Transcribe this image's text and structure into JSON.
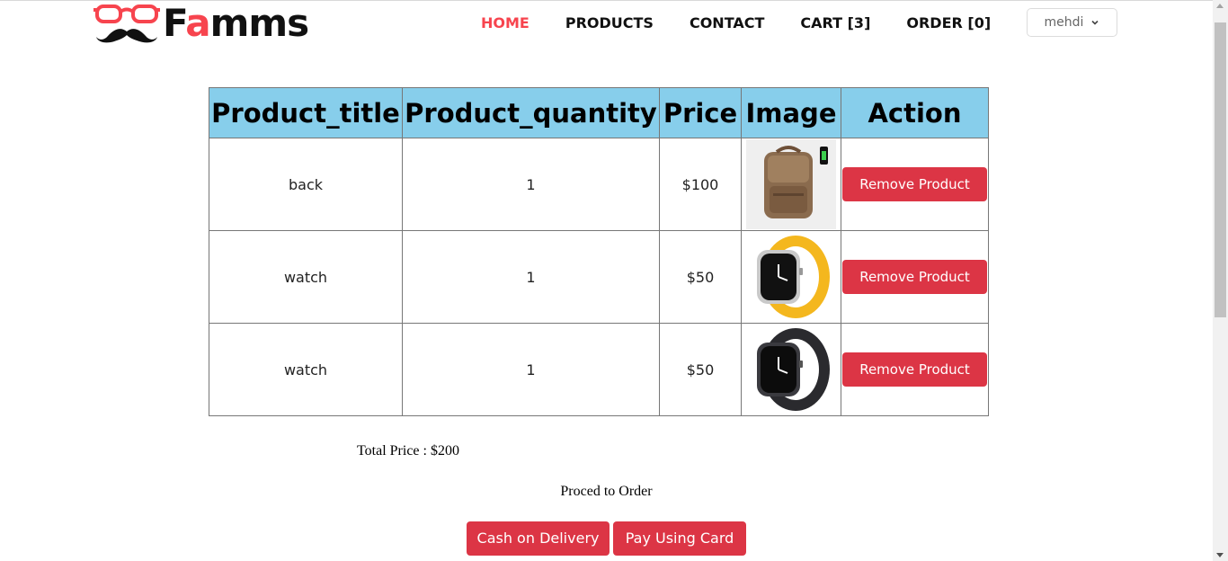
{
  "brand": {
    "name_prefix": "F",
    "name_accent": "a",
    "name_suffix": "mms"
  },
  "nav": {
    "items": [
      {
        "label": "HOME"
      },
      {
        "label": "PRODUCTS"
      },
      {
        "label": "CONTACT"
      },
      {
        "label": "CART [3]"
      },
      {
        "label": "ORDER [0]"
      }
    ]
  },
  "user": {
    "name": "mehdi"
  },
  "table": {
    "headers": [
      "Product_title",
      "Product_quantity",
      "Price",
      "Image",
      "Action"
    ],
    "rows": [
      {
        "title": "back",
        "quantity": "1",
        "price": "$100",
        "image": "backpack-image",
        "action": "Remove Product"
      },
      {
        "title": "watch",
        "quantity": "1",
        "price": "$50",
        "image": "yellow-watch-image",
        "action": "Remove Product"
      },
      {
        "title": "watch",
        "quantity": "1",
        "price": "$50",
        "image": "black-watch-image",
        "action": "Remove Product"
      }
    ]
  },
  "total": {
    "label": "Total Price : $200"
  },
  "proceed": {
    "label": "Proced to Order"
  },
  "payment": {
    "cod_label": "Cash on Delivery",
    "card_label": "Pay Using Card"
  },
  "colors": {
    "accent": "#f7444e",
    "header_bg": "#87ceeb",
    "button": "#dc3545"
  }
}
